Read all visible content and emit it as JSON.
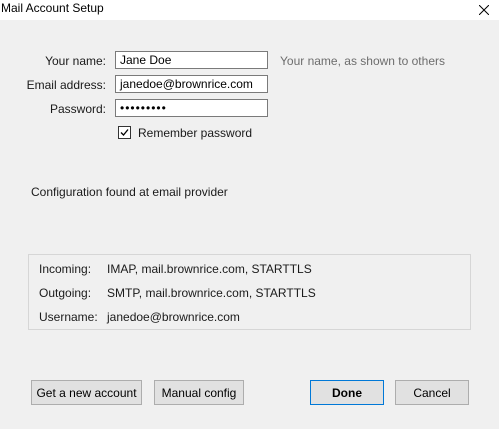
{
  "window": {
    "title": "Mail Account Setup"
  },
  "form": {
    "name_label": "Your name:",
    "name_value": "Jane Doe",
    "name_hint": "Your name, as shown to others",
    "email_label": "Email address:",
    "email_value": "janedoe@brownrice.com",
    "password_label": "Password:",
    "password_value": "•••••••••",
    "remember_label": "Remember password",
    "remember_checked": true
  },
  "status": {
    "message": "Configuration found at email provider"
  },
  "config": {
    "incoming_label": "Incoming:",
    "incoming_value": "IMAP, mail.brownrice.com, STARTTLS",
    "outgoing_label": "Outgoing:",
    "outgoing_value": "SMTP, mail.brownrice.com, STARTTLS",
    "username_label": "Username:",
    "username_value": "janedoe@brownrice.com"
  },
  "buttons": {
    "new_account": "Get a new account",
    "manual_config": "Manual config",
    "done": "Done",
    "cancel": "Cancel"
  },
  "icons": {
    "close": "close-icon",
    "checkbox": "checkmark-icon"
  }
}
